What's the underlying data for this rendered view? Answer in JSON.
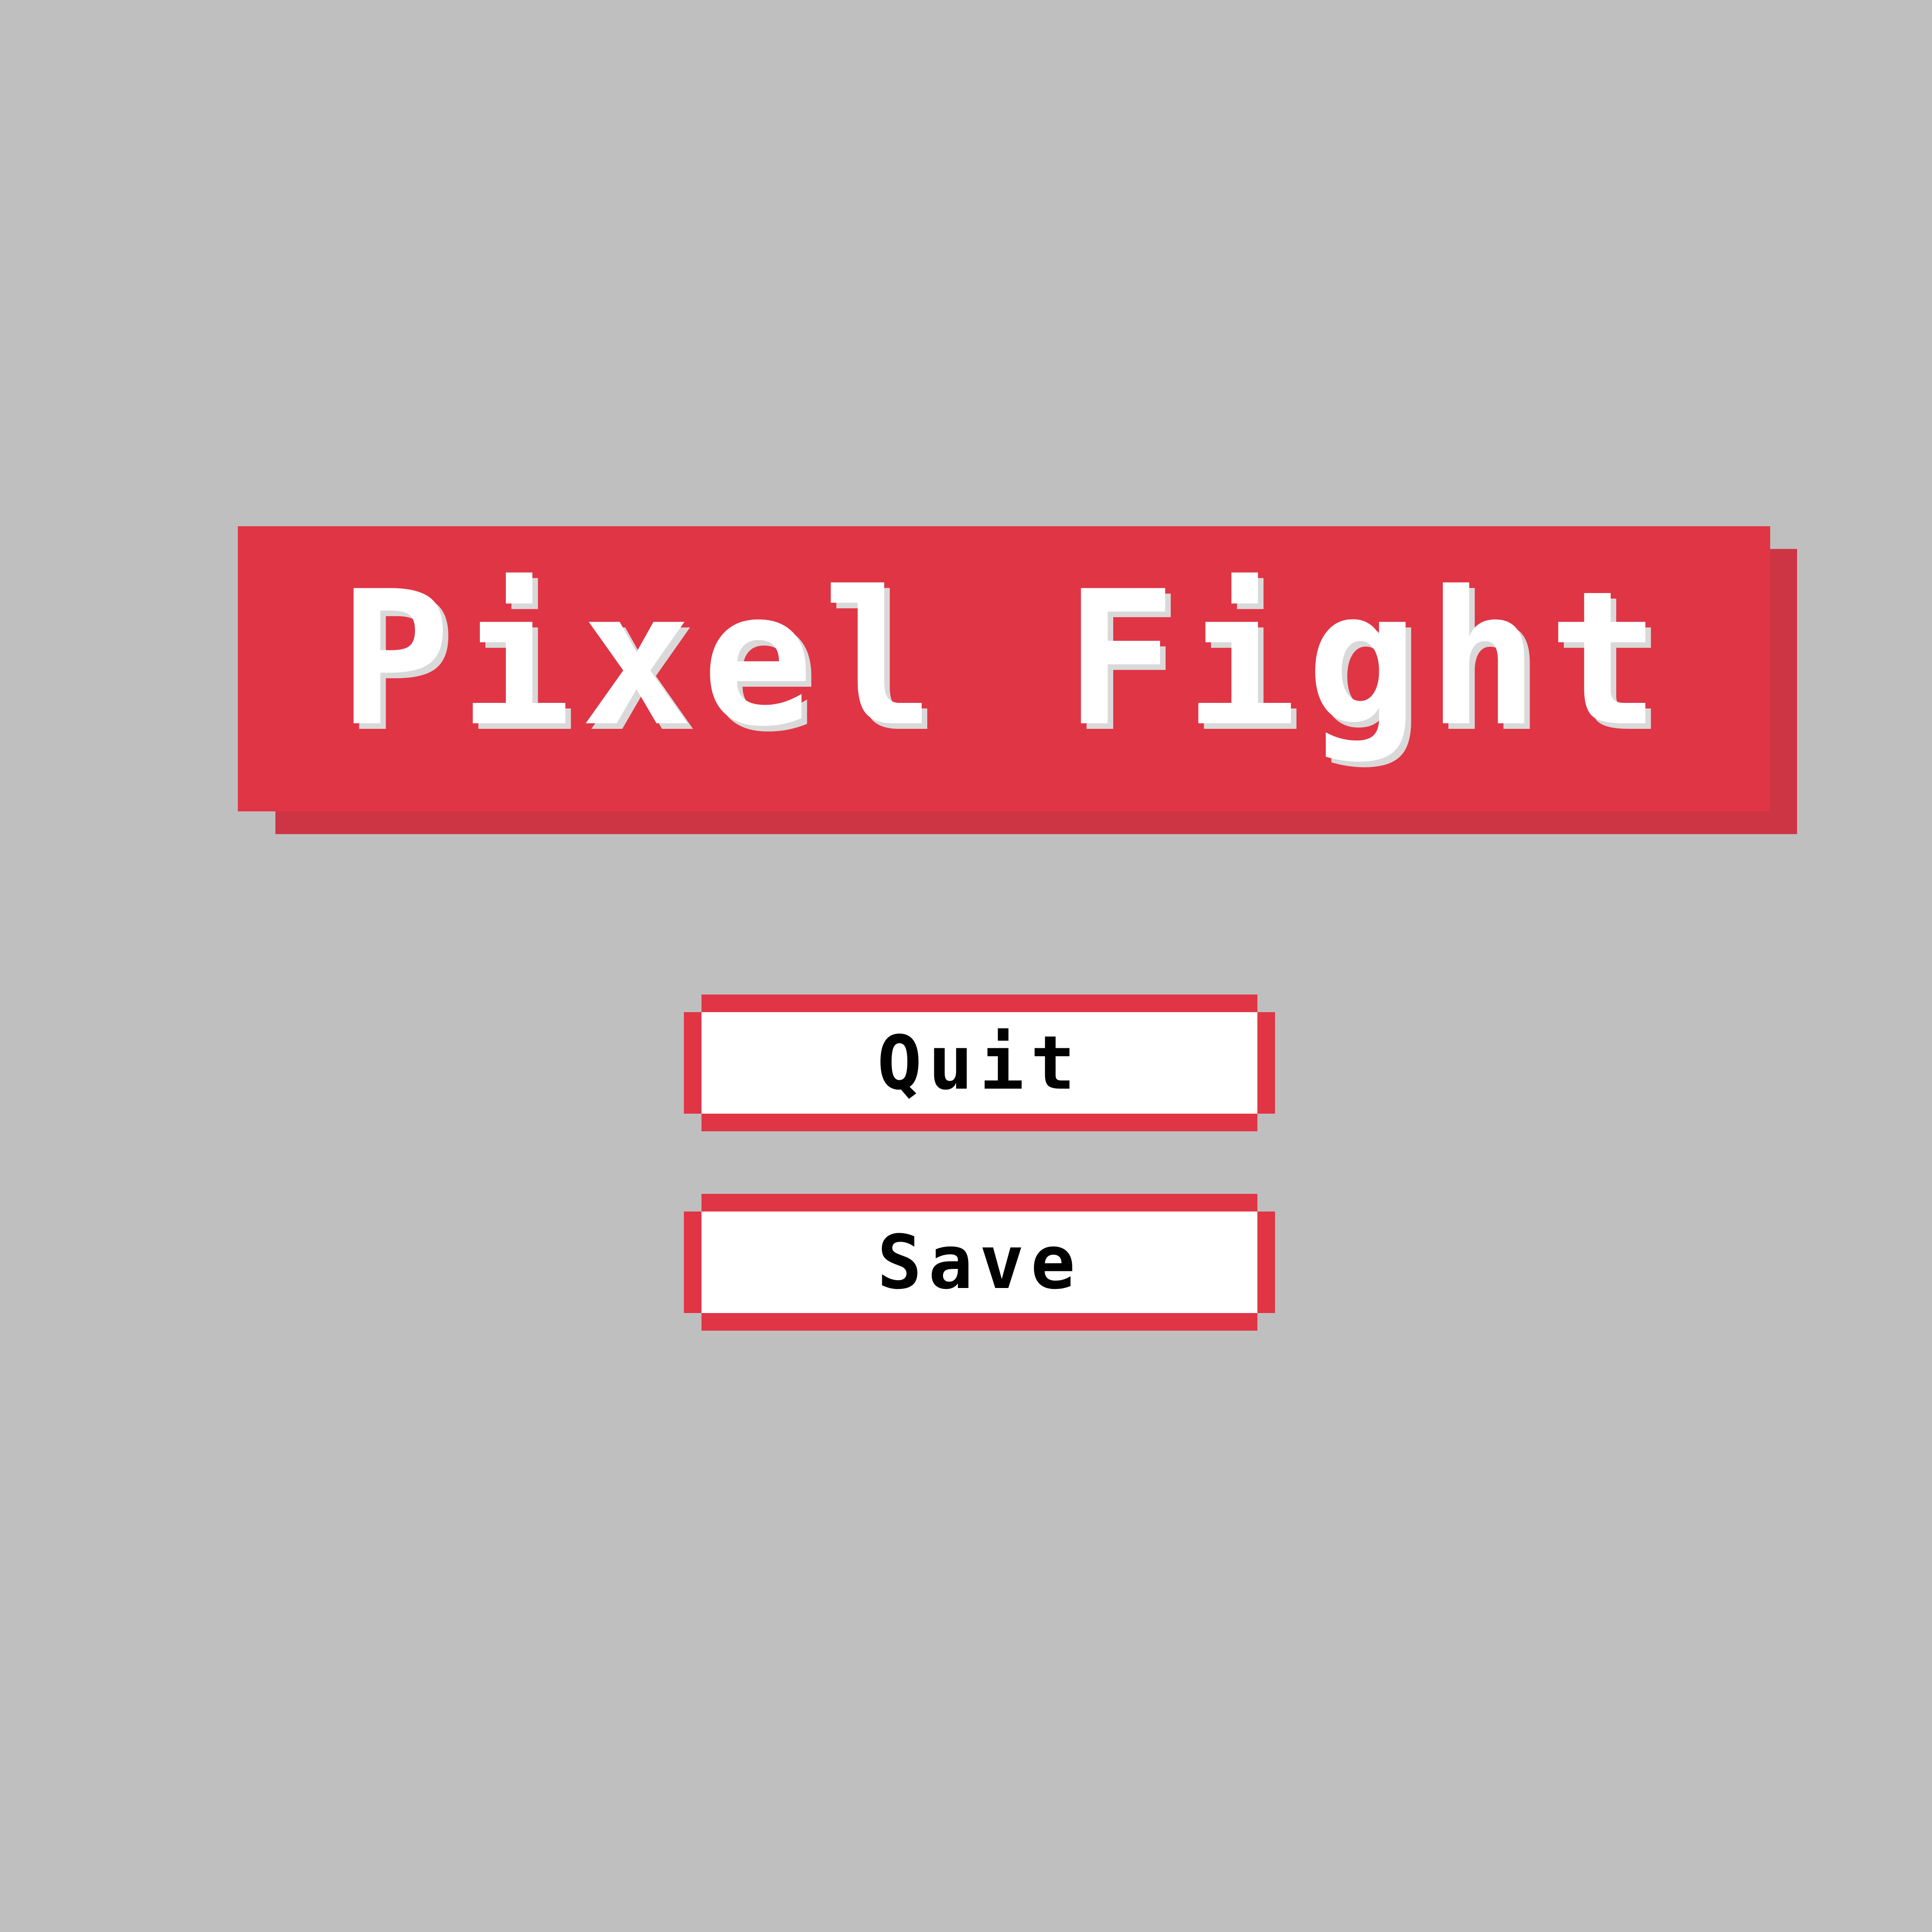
{
  "screen": "main-menu",
  "colors": {
    "background": "#bfbfbf",
    "accent": "#e03545",
    "accent_shadow": "#cd3545",
    "title_text": "#ffffff",
    "button_face": "#ffffff",
    "button_text": "#000000"
  },
  "title": {
    "text": "Pixel Fight"
  },
  "menu": {
    "buttons": [
      {
        "label": "Quit"
      },
      {
        "label": "Save"
      }
    ]
  }
}
